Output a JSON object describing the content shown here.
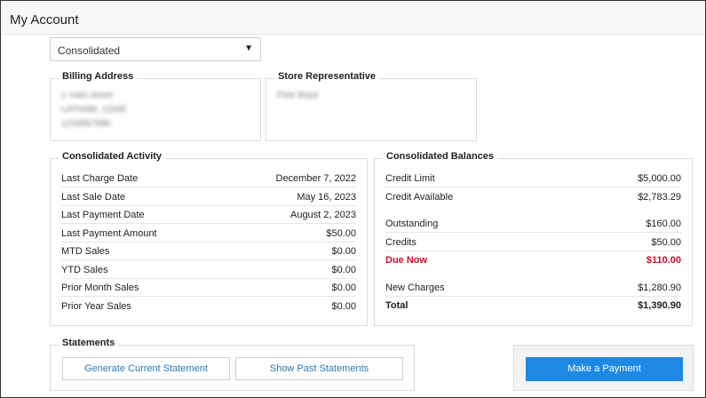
{
  "header": {
    "title": "My Account"
  },
  "account_select": {
    "value": "Consolidated",
    "arrow_icon": "triangle-down-icon"
  },
  "billing": {
    "title": "Billing Address",
    "lines": [
      "1 main street",
      "LATHAM, 12345",
      "1234567890"
    ]
  },
  "representative": {
    "title": "Store Representative",
    "name": "Pete Boyd"
  },
  "activity": {
    "title": "Consolidated Activity",
    "rows": [
      {
        "label": "Last Charge Date",
        "value": "December 7, 2022"
      },
      {
        "label": "Last Sale Date",
        "value": "May 16, 2023"
      },
      {
        "label": "Last Payment Date",
        "value": "August 2, 2023"
      },
      {
        "label": "Last Payment Amount",
        "value": "$50.00"
      },
      {
        "label": "MTD Sales",
        "value": "$0.00"
      },
      {
        "label": "YTD Sales",
        "value": "$0.00"
      },
      {
        "label": "Prior Month Sales",
        "value": "$0.00"
      },
      {
        "label": "Prior Year Sales",
        "value": "$0.00"
      }
    ]
  },
  "balances": {
    "title": "Consolidated Balances",
    "credit_limit": {
      "label": "Credit Limit",
      "value": "$5,000.00"
    },
    "credit_available": {
      "label": "Credit Available",
      "value": "$2,783.29"
    },
    "outstanding": {
      "label": "Outstanding",
      "value": "$160.00"
    },
    "credits": {
      "label": "Credits",
      "value": "$50.00"
    },
    "due_now": {
      "label": "Due Now",
      "value": "$110.00",
      "color": "#c8102e"
    },
    "new_charges": {
      "label": "New Charges",
      "value": "$1,280.90"
    },
    "total": {
      "label": "Total",
      "value": "$1,390.90"
    }
  },
  "statements": {
    "title": "Statements",
    "generate_label": "Generate Current Statement",
    "past_label": "Show Past Statements"
  },
  "payment": {
    "button_label": "Make a Payment",
    "color": "#1e88e5"
  }
}
